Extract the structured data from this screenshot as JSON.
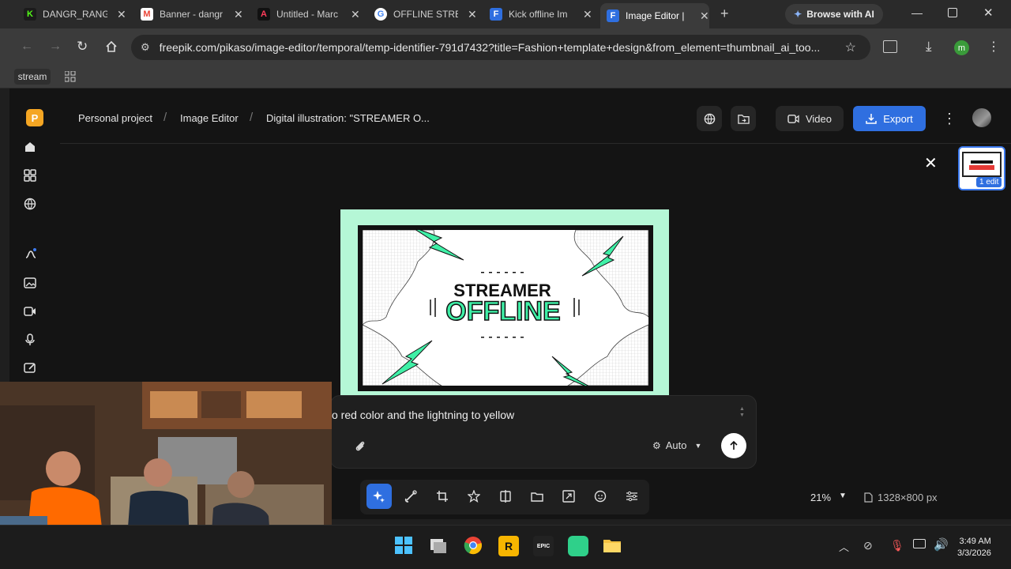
{
  "browser": {
    "tabs": [
      {
        "title": "DANGR_RANGR",
        "fav": "K",
        "fav_color": "#53fc18"
      },
      {
        "title": "Banner - dangr",
        "fav": "M",
        "fav_color": "#ea4335"
      },
      {
        "title": "Untitled - Marc",
        "fav": "A",
        "fav_color": "#6b2cff"
      },
      {
        "title": "OFFLINE STREA",
        "fav": "G",
        "fav_color": "#4285f4"
      },
      {
        "title": "Kick offline Im",
        "fav": "F",
        "fav_color": "#2f6fe0"
      },
      {
        "title": "Image Editor |",
        "fav": "F",
        "fav_color": "#2f6fe0"
      }
    ],
    "browse_ai_label": "Browse with AI",
    "url": "freepik.com/pikaso/image-editor/temporal/temp-identifier-791d7432?title=Fashion+template+design&from_element=thumbnail_ai_too...",
    "bookmark_label": "stream",
    "profile_initial": "m"
  },
  "app": {
    "logo_letter": "P",
    "breadcrumb": [
      "Personal project",
      "Image Editor",
      "Digital illustration: \"STREAMER O..."
    ],
    "video_label": "Video",
    "export_label": "Export",
    "thumb_badge": "1 edit",
    "canvas": {
      "line1": "STREAMER",
      "line2": "OFFLINE"
    },
    "prompt_text": "o red color and the lightning to yellow",
    "prompt_mode": "Auto",
    "zoom": "21%",
    "dimensions": "1328×800 px"
  },
  "taskbar": {
    "time": "3:49 AM",
    "date": "3/3/2026"
  }
}
